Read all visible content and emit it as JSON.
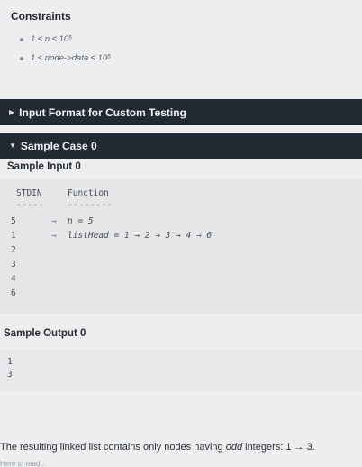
{
  "constraints": {
    "title": "Constraints",
    "items": [
      "1 ≤ n ≤ 10⁵",
      "1 ≤ node->data ≤ 10⁵"
    ]
  },
  "input_format_bar": {
    "label": "Input Format for Custom Testing",
    "icon": "triangle-right-icon"
  },
  "sample_case_bar": {
    "label": "Sample Case 0",
    "icon": "triangle-down-icon"
  },
  "sample_input": {
    "label": "Sample Input 0",
    "stdin_header": "STDIN",
    "function_header": "Function",
    "stdin_dashes": "-----",
    "function_dashes": "--------",
    "stdin_values": [
      "5",
      "1",
      "2",
      "3",
      "4",
      "6"
    ],
    "arrow": "→",
    "function_lines": [
      "n = 5",
      "listHead = 1 → 2 → 3 → 4 → 6"
    ]
  },
  "sample_output": {
    "label": "Sample Output 0",
    "values": [
      "1",
      "3"
    ]
  },
  "explanation": {
    "prefix": "The resulting linked list contains only nodes having ",
    "emphasis": "odd",
    "suffix": " integers: 1 → 3."
  },
  "cutoff_text": "Here to read..."
}
